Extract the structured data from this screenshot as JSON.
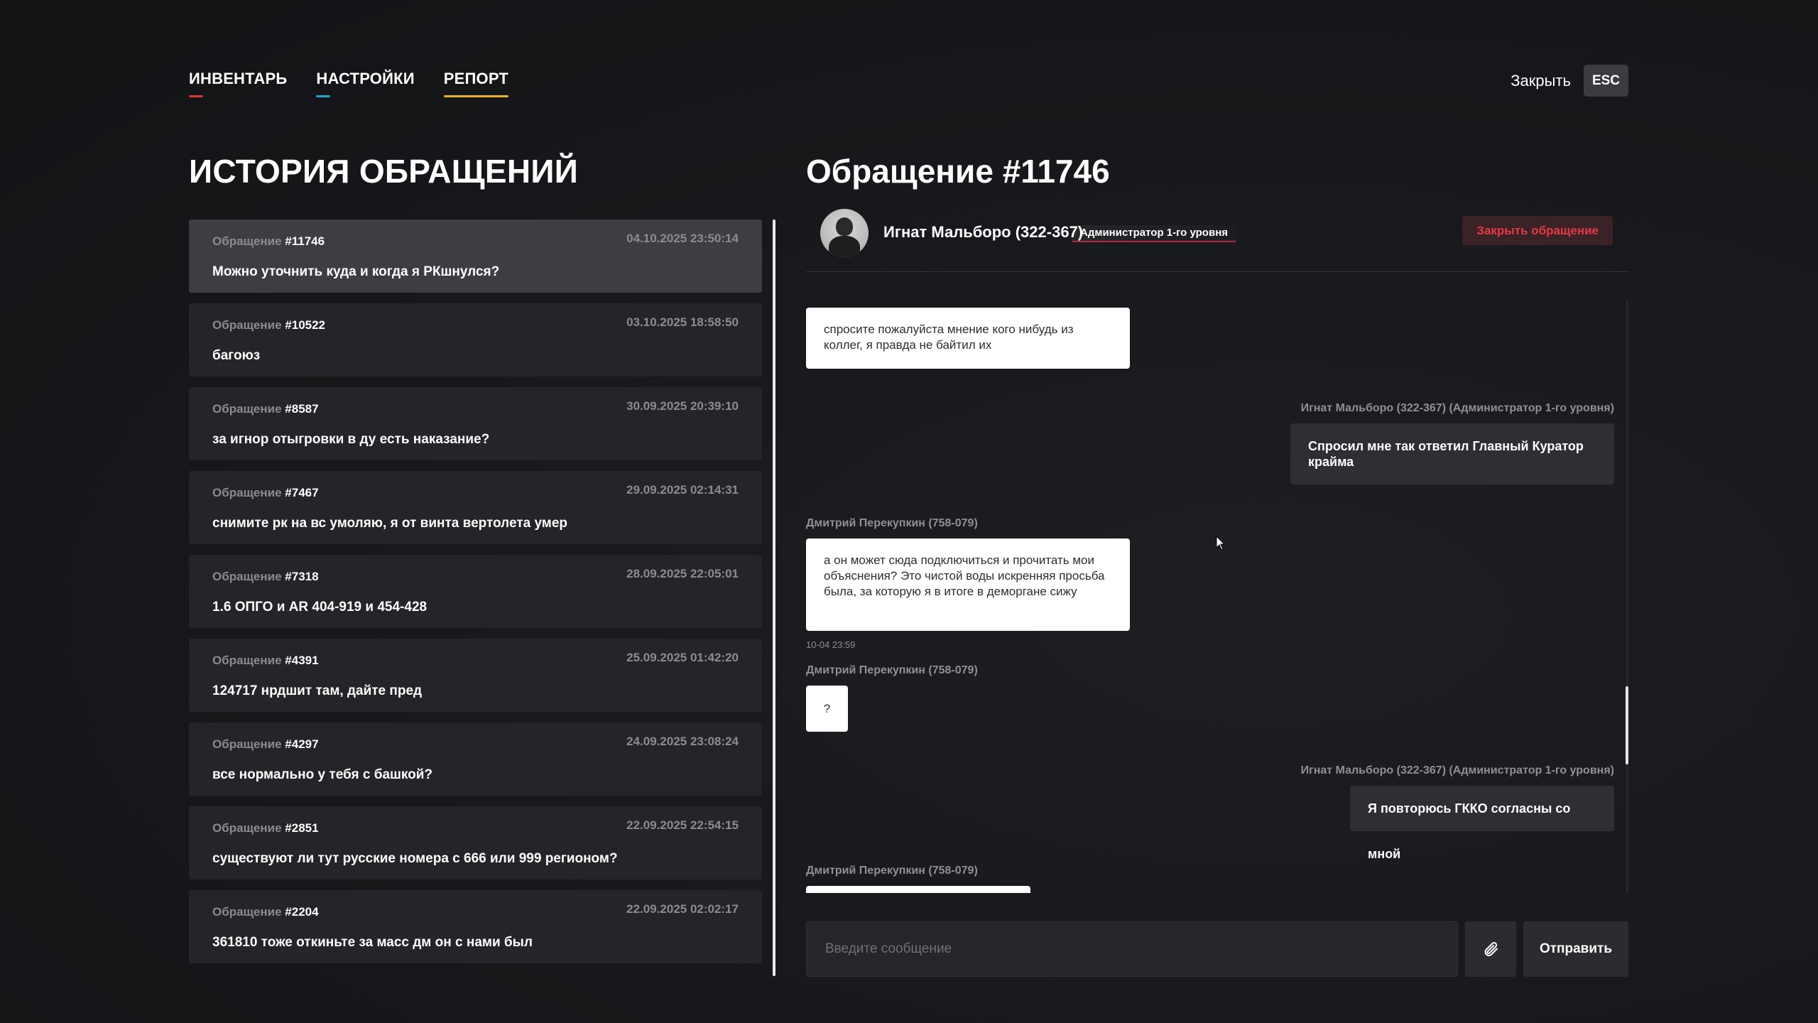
{
  "nav": {
    "tabs": [
      {
        "label": "ИНВЕНТАРЬ",
        "accent": "#e0342f"
      },
      {
        "label": "НАСТРОЙКИ",
        "accent": "#1aa8c8"
      },
      {
        "label": "РЕПОРТ",
        "accent": "#e8b12a",
        "active": true
      }
    ],
    "close_label": "Закрыть",
    "esc_label": "ESC"
  },
  "history": {
    "title": "ИСТОРИЯ ОБРАЩЕНИЙ",
    "item_prefix": "Обращение",
    "items": [
      {
        "number": "#11746",
        "date": "04.10.2025 23:50:14",
        "subject": "Можно уточнить куда и когда я РКшнулся?",
        "active": true
      },
      {
        "number": "#10522",
        "date": "03.10.2025 18:58:50",
        "subject": "багоюз"
      },
      {
        "number": "#8587",
        "date": "30.09.2025 20:39:10",
        "subject": "за игнор отыгровки в ду есть наказание?"
      },
      {
        "number": "#7467",
        "date": "29.09.2025 02:14:31",
        "subject": "снимите рк на вс умоляю, я от винта вертолета умер"
      },
      {
        "number": "#7318",
        "date": "28.09.2025 22:05:01",
        "subject": "1.6 ОПГО и AR 404-919 и 454-428"
      },
      {
        "number": "#4391",
        "date": "25.09.2025 01:42:20",
        "subject": "124717 нрдшит там, дайте пред"
      },
      {
        "number": "#4297",
        "date": "24.09.2025 23:08:24",
        "subject": "все нормально у тебя с башкой?"
      },
      {
        "number": "#2851",
        "date": "22.09.2025 22:54:15",
        "subject": "существуют ли тут русские номера с 666 или 999 регионом?"
      },
      {
        "number": "#2204",
        "date": "22.09.2025 02:02:17",
        "subject": "361810 тоже откиньте за масс дм он с нами был"
      }
    ]
  },
  "request": {
    "title": "Обращение #11746",
    "user_name": "Игнат Мальборо (322-367)",
    "user_role": "Администратор 1-го уровня",
    "close_button": "Закрыть обращение"
  },
  "chat": {
    "messages": [
      {
        "side": "in",
        "sender": "",
        "text": "спросите пожалуйста мнение кого нибудь из коллег, я правда не байтил их"
      },
      {
        "side": "out",
        "sender": "Игнат Мальборо (322-367) (Администратор 1-го уровня)",
        "text": "Спросил мне так ответил Главный Куратор крайма"
      },
      {
        "side": "in",
        "sender": "Дмитрий Перекупкин (758-079)",
        "text": "а он может сюда подключиться и прочитать мои объяснения? Это чистой воды искренняя просьба была, за которую я в итоге в деморгане сижу",
        "time": "10-04 23:59"
      },
      {
        "side": "in",
        "sender": "Дмитрий Перекупкин (758-079)",
        "text": "?"
      },
      {
        "side": "out",
        "sender": "Игнат Мальборо (322-367) (Администратор 1-го уровня)",
        "text": "Я повторюсь ГККО согласны со мной"
      },
      {
        "side": "in",
        "sender": "Дмитрий Перекупкин (758-079)",
        "text": ""
      }
    ]
  },
  "composer": {
    "placeholder": "Введите сообщение",
    "send_label": "Отправить"
  }
}
